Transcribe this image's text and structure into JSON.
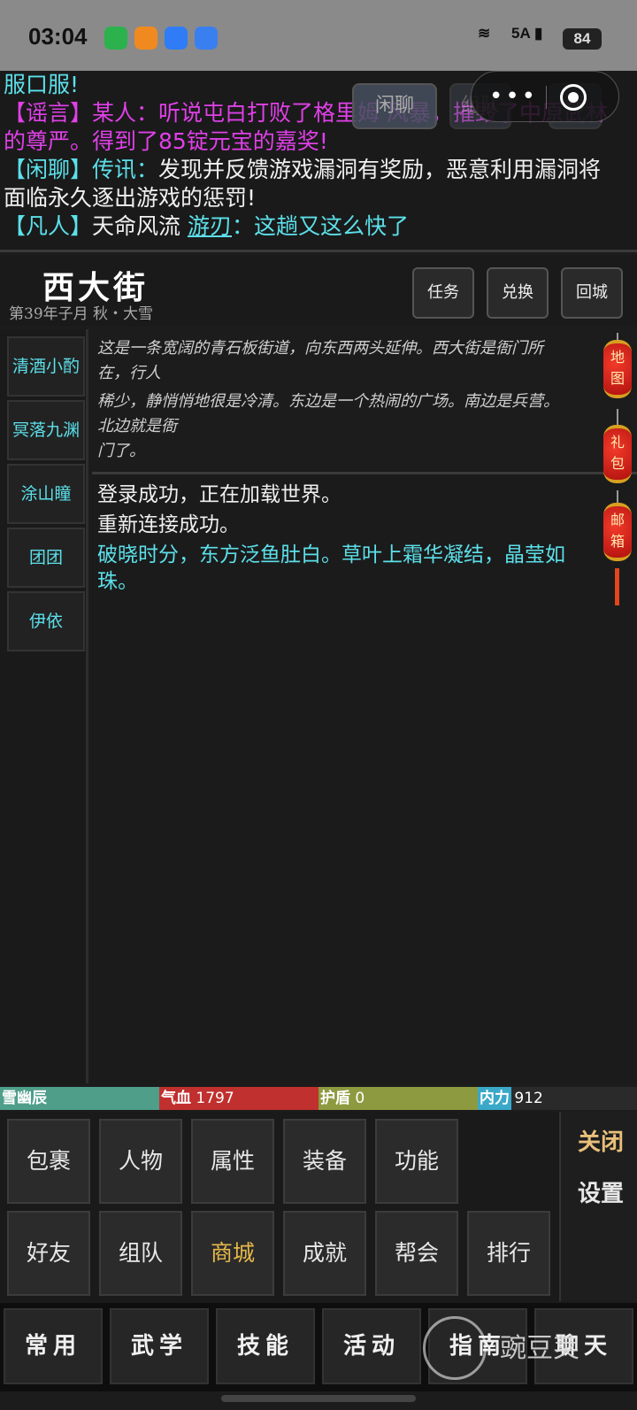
{
  "status_bar": {
    "time": "03:04",
    "network": "5A",
    "battery": "84"
  },
  "chat": {
    "line0": "服口服!",
    "rumor_tag": "【谣言】",
    "rumor_text": "某人：听说屯白打败了格里姆 风暴，摧毁了中原武林",
    "rumor_text2": "的尊严。得到了85锭元宝的嘉奖!",
    "idle_tag": "【闲聊】",
    "idle_speaker": "传讯：",
    "idle_text": "发现并反馈游戏漏洞有奖励，恶意利用漏洞将",
    "idle_text2": "面临永久逐出游戏的惩罚!",
    "mortal_tag": "【凡人】",
    "mortal_name": "天命风流",
    "mortal_link": "游刃",
    "mortal_text": "：这趟又这么快了",
    "tabs": [
      "闲聊",
      "组队",
      "帮"
    ]
  },
  "location": {
    "name": "西大街",
    "date": "第39年子月 秋・大雪",
    "buttons": {
      "task": "任务",
      "exchange": "兑换",
      "return": "回城"
    }
  },
  "npcs": [
    "清酒小酌",
    "冥落九渊",
    "涂山瞳",
    "团团",
    "伊依"
  ],
  "description": [
    "这是一条宽阔的青石板街道，向东西两头延伸。西大街是衙门所",
    "在，行人",
    "稀少，静悄悄地很是冷清。东边是一个热闹的广场。南边是兵营。",
    "北边就是衙",
    "门了。"
  ],
  "messages": {
    "m1": "登录成功，正在加载世界。",
    "m2": "重新连接成功。",
    "m3": "破晓时分，东方泛鱼肚白。草叶上霜华凝结，晶莹如",
    "m3b": "珠。"
  },
  "lanterns": {
    "map": [
      "地",
      "图"
    ],
    "gift": [
      "礼",
      "包"
    ],
    "mail": [
      "邮",
      "箱"
    ]
  },
  "stats": {
    "name": "雪幽辰",
    "hp_label": "气血",
    "hp_value": "1797",
    "shield_label": "护盾",
    "shield_value": "0",
    "mp_label": "内力",
    "mp_value": "912"
  },
  "actions": {
    "row1": [
      "包裹",
      "人物",
      "属性",
      "装备",
      "功能"
    ],
    "row2": [
      "好友",
      "组队",
      "商城",
      "成就",
      "帮会",
      "排行"
    ],
    "close": "关闭",
    "settings": "设置"
  },
  "nav": [
    "常用",
    "武学",
    "技能",
    "活动",
    "指南",
    "聊天"
  ],
  "watermark": "豌豆荚",
  "colors": {
    "cyan": "#5ce0ea",
    "magenta": "#e040e8",
    "gold": "#e6b84a",
    "hp_red": "#c0302e",
    "name_green": "#4e9e8a",
    "shield_olive": "#8e9a40",
    "mp_blue": "#3aa8c8"
  }
}
